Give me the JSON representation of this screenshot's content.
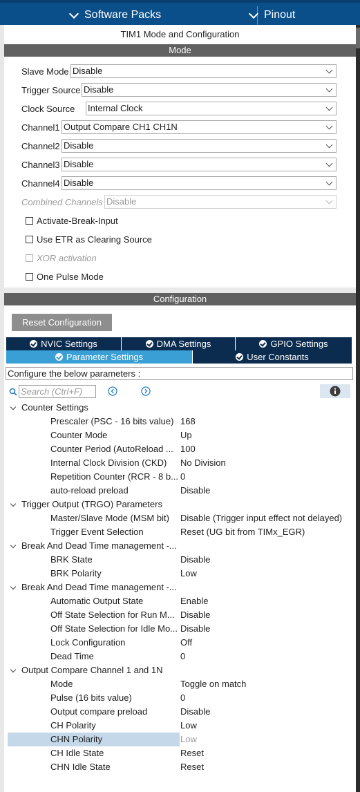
{
  "topbar": {
    "software_packs": "Software Packs",
    "pinout": "Pinout"
  },
  "title": "TIM1 Mode and Configuration",
  "mode": {
    "header": "Mode",
    "rows": [
      {
        "label": "Slave Mode",
        "value": "Disable",
        "disabled": false
      },
      {
        "label": "Trigger Source",
        "value": "Disable",
        "disabled": false
      },
      {
        "label": "Clock Source",
        "value": "Internal Clock",
        "disabled": false
      },
      {
        "label": "Channel1",
        "value": "Output Compare CH1 CH1N",
        "disabled": false
      },
      {
        "label": "Channel2",
        "value": "Disable",
        "disabled": false
      },
      {
        "label": "Channel3",
        "value": "Disable",
        "disabled": false
      },
      {
        "label": "Channel4",
        "value": "Disable",
        "disabled": false
      },
      {
        "label": "Combined Channels",
        "value": "Disable",
        "disabled": true
      }
    ],
    "checkboxes": [
      {
        "label": "Activate-Break-Input",
        "checked": false,
        "disabled": false
      },
      {
        "label": "Use ETR as Clearing Source",
        "checked": false,
        "disabled": false
      },
      {
        "label": "XOR activation",
        "checked": false,
        "disabled": true
      },
      {
        "label": "One Pulse Mode",
        "checked": false,
        "disabled": false
      }
    ]
  },
  "config": {
    "header": "Configuration",
    "reset_button": "Reset Configuration",
    "tabs": [
      {
        "label": "NVIC Settings",
        "active": false
      },
      {
        "label": "DMA Settings",
        "active": false
      },
      {
        "label": "GPIO Settings",
        "active": false
      },
      {
        "label": "Parameter Settings",
        "active": true
      },
      {
        "label": "User Constants",
        "active": false
      }
    ],
    "info_text": "Configure the below parameters :",
    "search_placeholder": "Search (Ctrl+F)",
    "groups": [
      {
        "name": "Counter Settings",
        "params": [
          {
            "name": "Prescaler (PSC - 16 bits value)",
            "value": "168"
          },
          {
            "name": "Counter Mode",
            "value": "Up"
          },
          {
            "name": "Counter Period (AutoReload ...",
            "value": "100"
          },
          {
            "name": "Internal Clock Division (CKD)",
            "value": "No Division"
          },
          {
            "name": "Repetition Counter (RCR - 8 b...",
            "value": "0"
          },
          {
            "name": "auto-reload preload",
            "value": "Disable"
          }
        ]
      },
      {
        "name": "Trigger Output (TRGO) Parameters",
        "params": [
          {
            "name": "Master/Slave Mode (MSM bit)",
            "value": "Disable (Trigger input effect not delayed)"
          },
          {
            "name": "Trigger Event Selection",
            "value": "Reset (UG bit from TIMx_EGR)"
          }
        ]
      },
      {
        "name": "Break And Dead Time management -...",
        "params": [
          {
            "name": "BRK State",
            "value": "Disable"
          },
          {
            "name": "BRK Polarity",
            "value": "Low"
          }
        ]
      },
      {
        "name": "Break And Dead Time management -...",
        "params": [
          {
            "name": "Automatic Output State",
            "value": "Enable"
          },
          {
            "name": "Off State Selection for Run M...",
            "value": "Disable"
          },
          {
            "name": "Off State Selection for Idle Mo...",
            "value": "Disable"
          },
          {
            "name": "Lock Configuration",
            "value": "Off"
          },
          {
            "name": "Dead Time",
            "value": "0"
          }
        ]
      },
      {
        "name": "Output Compare Channel 1 and 1N",
        "params": [
          {
            "name": "Mode",
            "value": "Toggle on match"
          },
          {
            "name": "Pulse (16 bits value)",
            "value": "0"
          },
          {
            "name": "Output compare preload",
            "value": "Disable"
          },
          {
            "name": "CH Polarity",
            "value": "Low"
          },
          {
            "name": "CHN Polarity",
            "value": "Low",
            "selected": true
          },
          {
            "name": "CH Idle State",
            "value": "Reset"
          },
          {
            "name": "CHN Idle State",
            "value": "Reset"
          }
        ]
      }
    ]
  },
  "colors": {
    "topbar": "#0b4f8a",
    "section_header": "#616161",
    "tab_dark": "#0b2c4f",
    "tab_active": "#3a9fd4",
    "selected_row": "#c4d8ea"
  }
}
